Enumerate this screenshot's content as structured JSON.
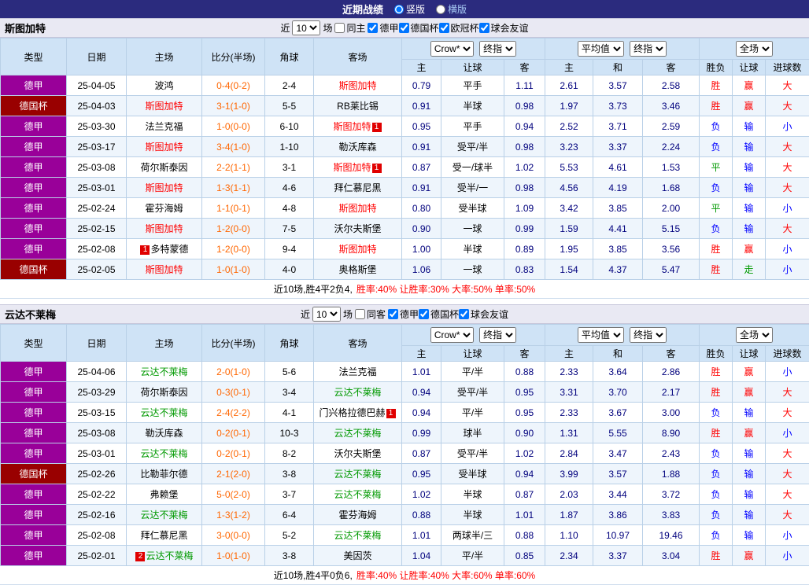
{
  "topbar": {
    "title": "近期战绩",
    "vertical": "竖版",
    "horizontal": "横版"
  },
  "filter_labels": {
    "near": "近",
    "count": "10",
    "games": "场"
  },
  "table_header": {
    "type": "类型",
    "date": "日期",
    "home": "主场",
    "score": "比分(半场)",
    "corner": "角球",
    "away": "客场",
    "sel_crow": "Crow*",
    "sel_final1": "终指",
    "sel_avg": "平均值",
    "sel_final2": "终指",
    "sel_full": "全场",
    "h": "主",
    "handicap": "让球",
    "a": "客",
    "h2": "主",
    "d": "和",
    "a2": "客",
    "wl": "胜负",
    "hwl": "让球",
    "goals": "进球数"
  },
  "colors": {
    "league_jia": "#990099",
    "league_bei": "#990000",
    "home_team": "#ff0000",
    "away_team": "#009900",
    "score": "#ff6600",
    "odds": "#00007d",
    "win": "#ff0000",
    "lose": "#0000ff",
    "draw": "#009900"
  },
  "sections": [
    {
      "team": "斯图加特",
      "same_label": "同主",
      "leagues": [
        "德甲",
        "德国杯",
        "欧冠杯",
        "球会友谊"
      ],
      "rows": [
        {
          "lg": "德甲",
          "lcls": "jia",
          "date": "25-04-05",
          "home": {
            "name": "波鸿",
            "cls": "t-black"
          },
          "score": "0-4(0-2)",
          "corner": "2-4",
          "away": {
            "name": "斯图加特",
            "cls": "t-red"
          },
          "o1": [
            "0.79",
            "平手",
            "1.11"
          ],
          "o2": [
            "2.61",
            "3.57",
            "2.58"
          ],
          "res": [
            [
              "胜",
              "r"
            ],
            [
              "赢",
              "r"
            ],
            [
              "大",
              "r"
            ]
          ]
        },
        {
          "lg": "德国杯",
          "lcls": "bei",
          "date": "25-04-03",
          "home": {
            "name": "斯图加特",
            "cls": "t-red"
          },
          "score": "3-1(1-0)",
          "corner": "5-5",
          "away": {
            "name": "RB莱比锡",
            "cls": "t-black"
          },
          "o1": [
            "0.91",
            "半球",
            "0.98"
          ],
          "o2": [
            "1.97",
            "3.73",
            "3.46"
          ],
          "res": [
            [
              "胜",
              "r"
            ],
            [
              "赢",
              "r"
            ],
            [
              "大",
              "r"
            ]
          ]
        },
        {
          "lg": "德甲",
          "lcls": "jia",
          "date": "25-03-30",
          "home": {
            "name": "法兰克福",
            "cls": "t-black"
          },
          "score": "1-0(0-0)",
          "corner": "6-10",
          "away": {
            "name": "斯图加特",
            "cls": "t-red",
            "ba": "1"
          },
          "o1": [
            "0.95",
            "平手",
            "0.94"
          ],
          "o2": [
            "2.52",
            "3.71",
            "2.59"
          ],
          "res": [
            [
              "负",
              "b"
            ],
            [
              "输",
              "b"
            ],
            [
              "小",
              "b"
            ]
          ]
        },
        {
          "lg": "德甲",
          "lcls": "jia",
          "date": "25-03-17",
          "home": {
            "name": "斯图加特",
            "cls": "t-red"
          },
          "score": "3-4(1-0)",
          "corner": "1-10",
          "away": {
            "name": "勒沃库森",
            "cls": "t-black"
          },
          "o1": [
            "0.91",
            "受平/半",
            "0.98"
          ],
          "o2": [
            "3.23",
            "3.37",
            "2.24"
          ],
          "res": [
            [
              "负",
              "b"
            ],
            [
              "输",
              "b"
            ],
            [
              "大",
              "r"
            ]
          ]
        },
        {
          "lg": "德甲",
          "lcls": "jia",
          "date": "25-03-08",
          "home": {
            "name": "荷尔斯泰因",
            "cls": "t-black"
          },
          "score": "2-2(1-1)",
          "corner": "3-1",
          "away": {
            "name": "斯图加特",
            "cls": "t-red",
            "ba": "1"
          },
          "o1": [
            "0.87",
            "受一/球半",
            "1.02"
          ],
          "o2": [
            "5.53",
            "4.61",
            "1.53"
          ],
          "res": [
            [
              "平",
              "g"
            ],
            [
              "输",
              "b"
            ],
            [
              "大",
              "r"
            ]
          ]
        },
        {
          "lg": "德甲",
          "lcls": "jia",
          "date": "25-03-01",
          "home": {
            "name": "斯图加特",
            "cls": "t-red"
          },
          "score": "1-3(1-1)",
          "corner": "4-6",
          "away": {
            "name": "拜仁慕尼黑",
            "cls": "t-black"
          },
          "o1": [
            "0.91",
            "受半/一",
            "0.98"
          ],
          "o2": [
            "4.56",
            "4.19",
            "1.68"
          ],
          "res": [
            [
              "负",
              "b"
            ],
            [
              "输",
              "b"
            ],
            [
              "大",
              "r"
            ]
          ]
        },
        {
          "lg": "德甲",
          "lcls": "jia",
          "date": "25-02-24",
          "home": {
            "name": "霍芬海姆",
            "cls": "t-black"
          },
          "score": "1-1(0-1)",
          "corner": "4-8",
          "away": {
            "name": "斯图加特",
            "cls": "t-red"
          },
          "o1": [
            "0.80",
            "受半球",
            "1.09"
          ],
          "o2": [
            "3.42",
            "3.85",
            "2.00"
          ],
          "res": [
            [
              "平",
              "g"
            ],
            [
              "输",
              "b"
            ],
            [
              "小",
              "b"
            ]
          ]
        },
        {
          "lg": "德甲",
          "lcls": "jia",
          "date": "25-02-15",
          "home": {
            "name": "斯图加特",
            "cls": "t-red"
          },
          "score": "1-2(0-0)",
          "corner": "7-5",
          "away": {
            "name": "沃尔夫斯堡",
            "cls": "t-black"
          },
          "o1": [
            "0.90",
            "一球",
            "0.99"
          ],
          "o2": [
            "1.59",
            "4.41",
            "5.15"
          ],
          "res": [
            [
              "负",
              "b"
            ],
            [
              "输",
              "b"
            ],
            [
              "大",
              "r"
            ]
          ]
        },
        {
          "lg": "德甲",
          "lcls": "jia",
          "date": "25-02-08",
          "home": {
            "name": "多特蒙德",
            "cls": "t-black",
            "bb": "1"
          },
          "score": "1-2(0-0)",
          "corner": "9-4",
          "away": {
            "name": "斯图加特",
            "cls": "t-red"
          },
          "o1": [
            "1.00",
            "半球",
            "0.89"
          ],
          "o2": [
            "1.95",
            "3.85",
            "3.56"
          ],
          "res": [
            [
              "胜",
              "r"
            ],
            [
              "赢",
              "r"
            ],
            [
              "小",
              "b"
            ]
          ]
        },
        {
          "lg": "德国杯",
          "lcls": "bei",
          "date": "25-02-05",
          "home": {
            "name": "斯图加特",
            "cls": "t-red"
          },
          "score": "1-0(1-0)",
          "corner": "4-0",
          "away": {
            "name": "奥格斯堡",
            "cls": "t-black"
          },
          "o1": [
            "1.06",
            "一球",
            "0.83"
          ],
          "o2": [
            "1.54",
            "4.37",
            "5.47"
          ],
          "res": [
            [
              "胜",
              "r"
            ],
            [
              "走",
              "g"
            ],
            [
              "小",
              "b"
            ]
          ]
        }
      ],
      "summary_prefix": "近10场,胜4平2负4,",
      "summary_stats": "胜率:40% 让胜率:30% 大率:50% 单率:50%"
    },
    {
      "team": "云达不莱梅",
      "same_label": "同客",
      "leagues": [
        "德甲",
        "德国杯",
        "球会友谊"
      ],
      "rows": [
        {
          "lg": "德甲",
          "lcls": "jia",
          "date": "25-04-06",
          "home": {
            "name": "云达不莱梅",
            "cls": "t-green"
          },
          "score": "2-0(1-0)",
          "corner": "5-6",
          "away": {
            "name": "法兰克福",
            "cls": "t-black"
          },
          "o1": [
            "1.01",
            "平/半",
            "0.88"
          ],
          "o2": [
            "2.33",
            "3.64",
            "2.86"
          ],
          "res": [
            [
              "胜",
              "r"
            ],
            [
              "赢",
              "r"
            ],
            [
              "小",
              "b"
            ]
          ]
        },
        {
          "lg": "德甲",
          "lcls": "jia",
          "date": "25-03-29",
          "home": {
            "name": "荷尔斯泰因",
            "cls": "t-black"
          },
          "score": "0-3(0-1)",
          "corner": "3-4",
          "away": {
            "name": "云达不莱梅",
            "cls": "t-green"
          },
          "o1": [
            "0.94",
            "受平/半",
            "0.95"
          ],
          "o2": [
            "3.31",
            "3.70",
            "2.17"
          ],
          "res": [
            [
              "胜",
              "r"
            ],
            [
              "赢",
              "r"
            ],
            [
              "大",
              "r"
            ]
          ]
        },
        {
          "lg": "德甲",
          "lcls": "jia",
          "date": "25-03-15",
          "home": {
            "name": "云达不莱梅",
            "cls": "t-green"
          },
          "score": "2-4(2-2)",
          "corner": "4-1",
          "away": {
            "name": "门兴格拉德巴赫",
            "cls": "t-black",
            "ba": "1"
          },
          "o1": [
            "0.94",
            "平/半",
            "0.95"
          ],
          "o2": [
            "2.33",
            "3.67",
            "3.00"
          ],
          "res": [
            [
              "负",
              "b"
            ],
            [
              "输",
              "b"
            ],
            [
              "大",
              "r"
            ]
          ]
        },
        {
          "lg": "德甲",
          "lcls": "jia",
          "date": "25-03-08",
          "home": {
            "name": "勒沃库森",
            "cls": "t-black"
          },
          "score": "0-2(0-1)",
          "corner": "10-3",
          "away": {
            "name": "云达不莱梅",
            "cls": "t-green"
          },
          "o1": [
            "0.99",
            "球半",
            "0.90"
          ],
          "o2": [
            "1.31",
            "5.55",
            "8.90"
          ],
          "res": [
            [
              "胜",
              "r"
            ],
            [
              "赢",
              "r"
            ],
            [
              "小",
              "b"
            ]
          ]
        },
        {
          "lg": "德甲",
          "lcls": "jia",
          "date": "25-03-01",
          "home": {
            "name": "云达不莱梅",
            "cls": "t-green"
          },
          "score": "0-2(0-1)",
          "corner": "8-2",
          "away": {
            "name": "沃尔夫斯堡",
            "cls": "t-black"
          },
          "o1": [
            "0.87",
            "受平/半",
            "1.02"
          ],
          "o2": [
            "2.84",
            "3.47",
            "2.43"
          ],
          "res": [
            [
              "负",
              "b"
            ],
            [
              "输",
              "b"
            ],
            [
              "大",
              "r"
            ]
          ]
        },
        {
          "lg": "德国杯",
          "lcls": "bei",
          "date": "25-02-26",
          "home": {
            "name": "比勒菲尔德",
            "cls": "t-black"
          },
          "score": "2-1(2-0)",
          "corner": "3-8",
          "away": {
            "name": "云达不莱梅",
            "cls": "t-green"
          },
          "o1": [
            "0.95",
            "受半球",
            "0.94"
          ],
          "o2": [
            "3.99",
            "3.57",
            "1.88"
          ],
          "res": [
            [
              "负",
              "b"
            ],
            [
              "输",
              "b"
            ],
            [
              "大",
              "r"
            ]
          ]
        },
        {
          "lg": "德甲",
          "lcls": "jia",
          "date": "25-02-22",
          "home": {
            "name": "弗赖堡",
            "cls": "t-black"
          },
          "score": "5-0(2-0)",
          "corner": "3-7",
          "away": {
            "name": "云达不莱梅",
            "cls": "t-green"
          },
          "o1": [
            "1.02",
            "半球",
            "0.87"
          ],
          "o2": [
            "2.03",
            "3.44",
            "3.72"
          ],
          "res": [
            [
              "负",
              "b"
            ],
            [
              "输",
              "b"
            ],
            [
              "大",
              "r"
            ]
          ]
        },
        {
          "lg": "德甲",
          "lcls": "jia",
          "date": "25-02-16",
          "home": {
            "name": "云达不莱梅",
            "cls": "t-green"
          },
          "score": "1-3(1-2)",
          "corner": "6-4",
          "away": {
            "name": "霍芬海姆",
            "cls": "t-black"
          },
          "o1": [
            "0.88",
            "半球",
            "1.01"
          ],
          "o2": [
            "1.87",
            "3.86",
            "3.83"
          ],
          "res": [
            [
              "负",
              "b"
            ],
            [
              "输",
              "b"
            ],
            [
              "大",
              "r"
            ]
          ]
        },
        {
          "lg": "德甲",
          "lcls": "jia",
          "date": "25-02-08",
          "home": {
            "name": "拜仁慕尼黑",
            "cls": "t-black"
          },
          "score": "3-0(0-0)",
          "corner": "5-2",
          "away": {
            "name": "云达不莱梅",
            "cls": "t-green"
          },
          "o1": [
            "1.01",
            "两球半/三",
            "0.88"
          ],
          "o2": [
            "1.10",
            "10.97",
            "19.46"
          ],
          "res": [
            [
              "负",
              "b"
            ],
            [
              "输",
              "b"
            ],
            [
              "小",
              "b"
            ]
          ]
        },
        {
          "lg": "德甲",
          "lcls": "jia",
          "date": "25-02-01",
          "home": {
            "name": "云达不莱梅",
            "cls": "t-green",
            "bb": "2"
          },
          "score": "1-0(1-0)",
          "corner": "3-8",
          "away": {
            "name": "美因茨",
            "cls": "t-black"
          },
          "o1": [
            "1.04",
            "平/半",
            "0.85"
          ],
          "o2": [
            "2.34",
            "3.37",
            "3.04"
          ],
          "res": [
            [
              "胜",
              "r"
            ],
            [
              "赢",
              "r"
            ],
            [
              "小",
              "b"
            ]
          ]
        }
      ],
      "summary_prefix": "近10场,胜4平0负6,",
      "summary_stats": "胜率:40% 让胜率:40% 大率:60% 单率:60%"
    }
  ]
}
